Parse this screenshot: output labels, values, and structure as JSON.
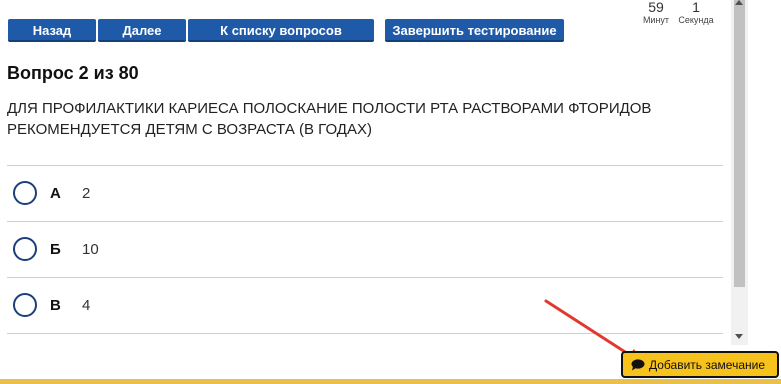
{
  "toolbar": {
    "back_label": "Назад",
    "next_label": "Далее",
    "list_label": "К списку вопросов",
    "finish_label": "Завершить тестирование"
  },
  "timer": {
    "minutes": "59",
    "minutes_label": "Минут",
    "seconds": "1",
    "seconds_label": "Секунда"
  },
  "question": {
    "title": "Вопрос 2 из 80",
    "text": "ДЛЯ ПРОФИЛАКТИКИ КАРИЕСА ПОЛОСКАНИЕ ПОЛОСТИ РТА РАСТВОРАМИ ФТОРИДОВ РЕКОМЕНДУЕТСЯ ДЕТЯМ С ВОЗРАСТА (В ГОДАХ)"
  },
  "options": [
    {
      "letter": "А",
      "value": "2"
    },
    {
      "letter": "Б",
      "value": "10"
    },
    {
      "letter": "В",
      "value": "4"
    }
  ],
  "remark": {
    "label": "Добавить замечание",
    "icon": "speech-bubble-icon"
  },
  "colors": {
    "button_blue": "#1f5aa8",
    "remark_yellow": "#f7c21c",
    "radio_border": "#1b3f7a",
    "annotation_red": "#e03a2f"
  }
}
